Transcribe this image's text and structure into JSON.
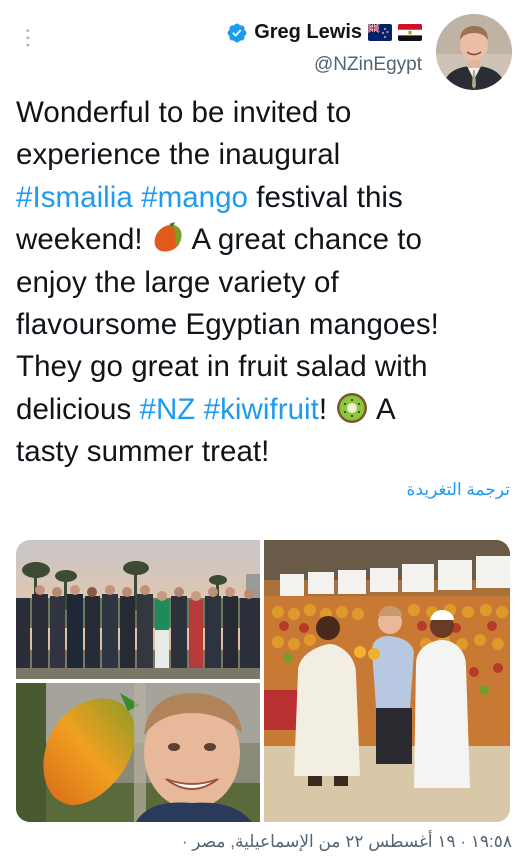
{
  "header": {
    "display_name": "Greg Lewis",
    "handle": "@NZinEgypt",
    "more_icon": "more-vertical-icon",
    "verified_icon": "verified-badge-icon",
    "flags": [
      "new-zealand-flag-icon",
      "egypt-flag-icon"
    ]
  },
  "tweet": {
    "lines": [
      [
        {
          "t": "Wonderful to be invited to"
        }
      ],
      [
        {
          "t": "experience the inaugural"
        }
      ],
      [
        {
          "t": "#Ismailia",
          "h": true
        },
        {
          "t": " "
        },
        {
          "t": "#mango",
          "h": true
        },
        {
          "t": " festival this"
        }
      ],
      [
        {
          "t": "weekend! "
        },
        {
          "emoji": "mango-emoji-icon"
        },
        {
          "t": " A great chance to"
        }
      ],
      [
        {
          "t": "enjoy the large variety of"
        }
      ],
      [
        {
          "t": "flavoursome Egyptian mangoes!"
        }
      ],
      [
        {
          "t": "They go great in fruit salad with"
        }
      ],
      [
        {
          "t": "delicious  "
        },
        {
          "t": "#NZ",
          "h": true
        },
        {
          "t": " "
        },
        {
          "t": "#kiwifruit",
          "h": true
        },
        {
          "t": "! "
        },
        {
          "emoji": "kiwi-emoji-icon"
        },
        {
          "t": " A"
        }
      ],
      [
        {
          "t": "tasty summer treat!"
        }
      ]
    ]
  },
  "translate_label": "ترجمة التغريدة",
  "timestamp": "١٩:٥٨ · ١٩ أغسطس ٢٢ من الإسماعيلية, مصر ·",
  "colors": {
    "link": "#1d9bf0",
    "secondary_text": "#536471",
    "text": "#0f1419"
  }
}
